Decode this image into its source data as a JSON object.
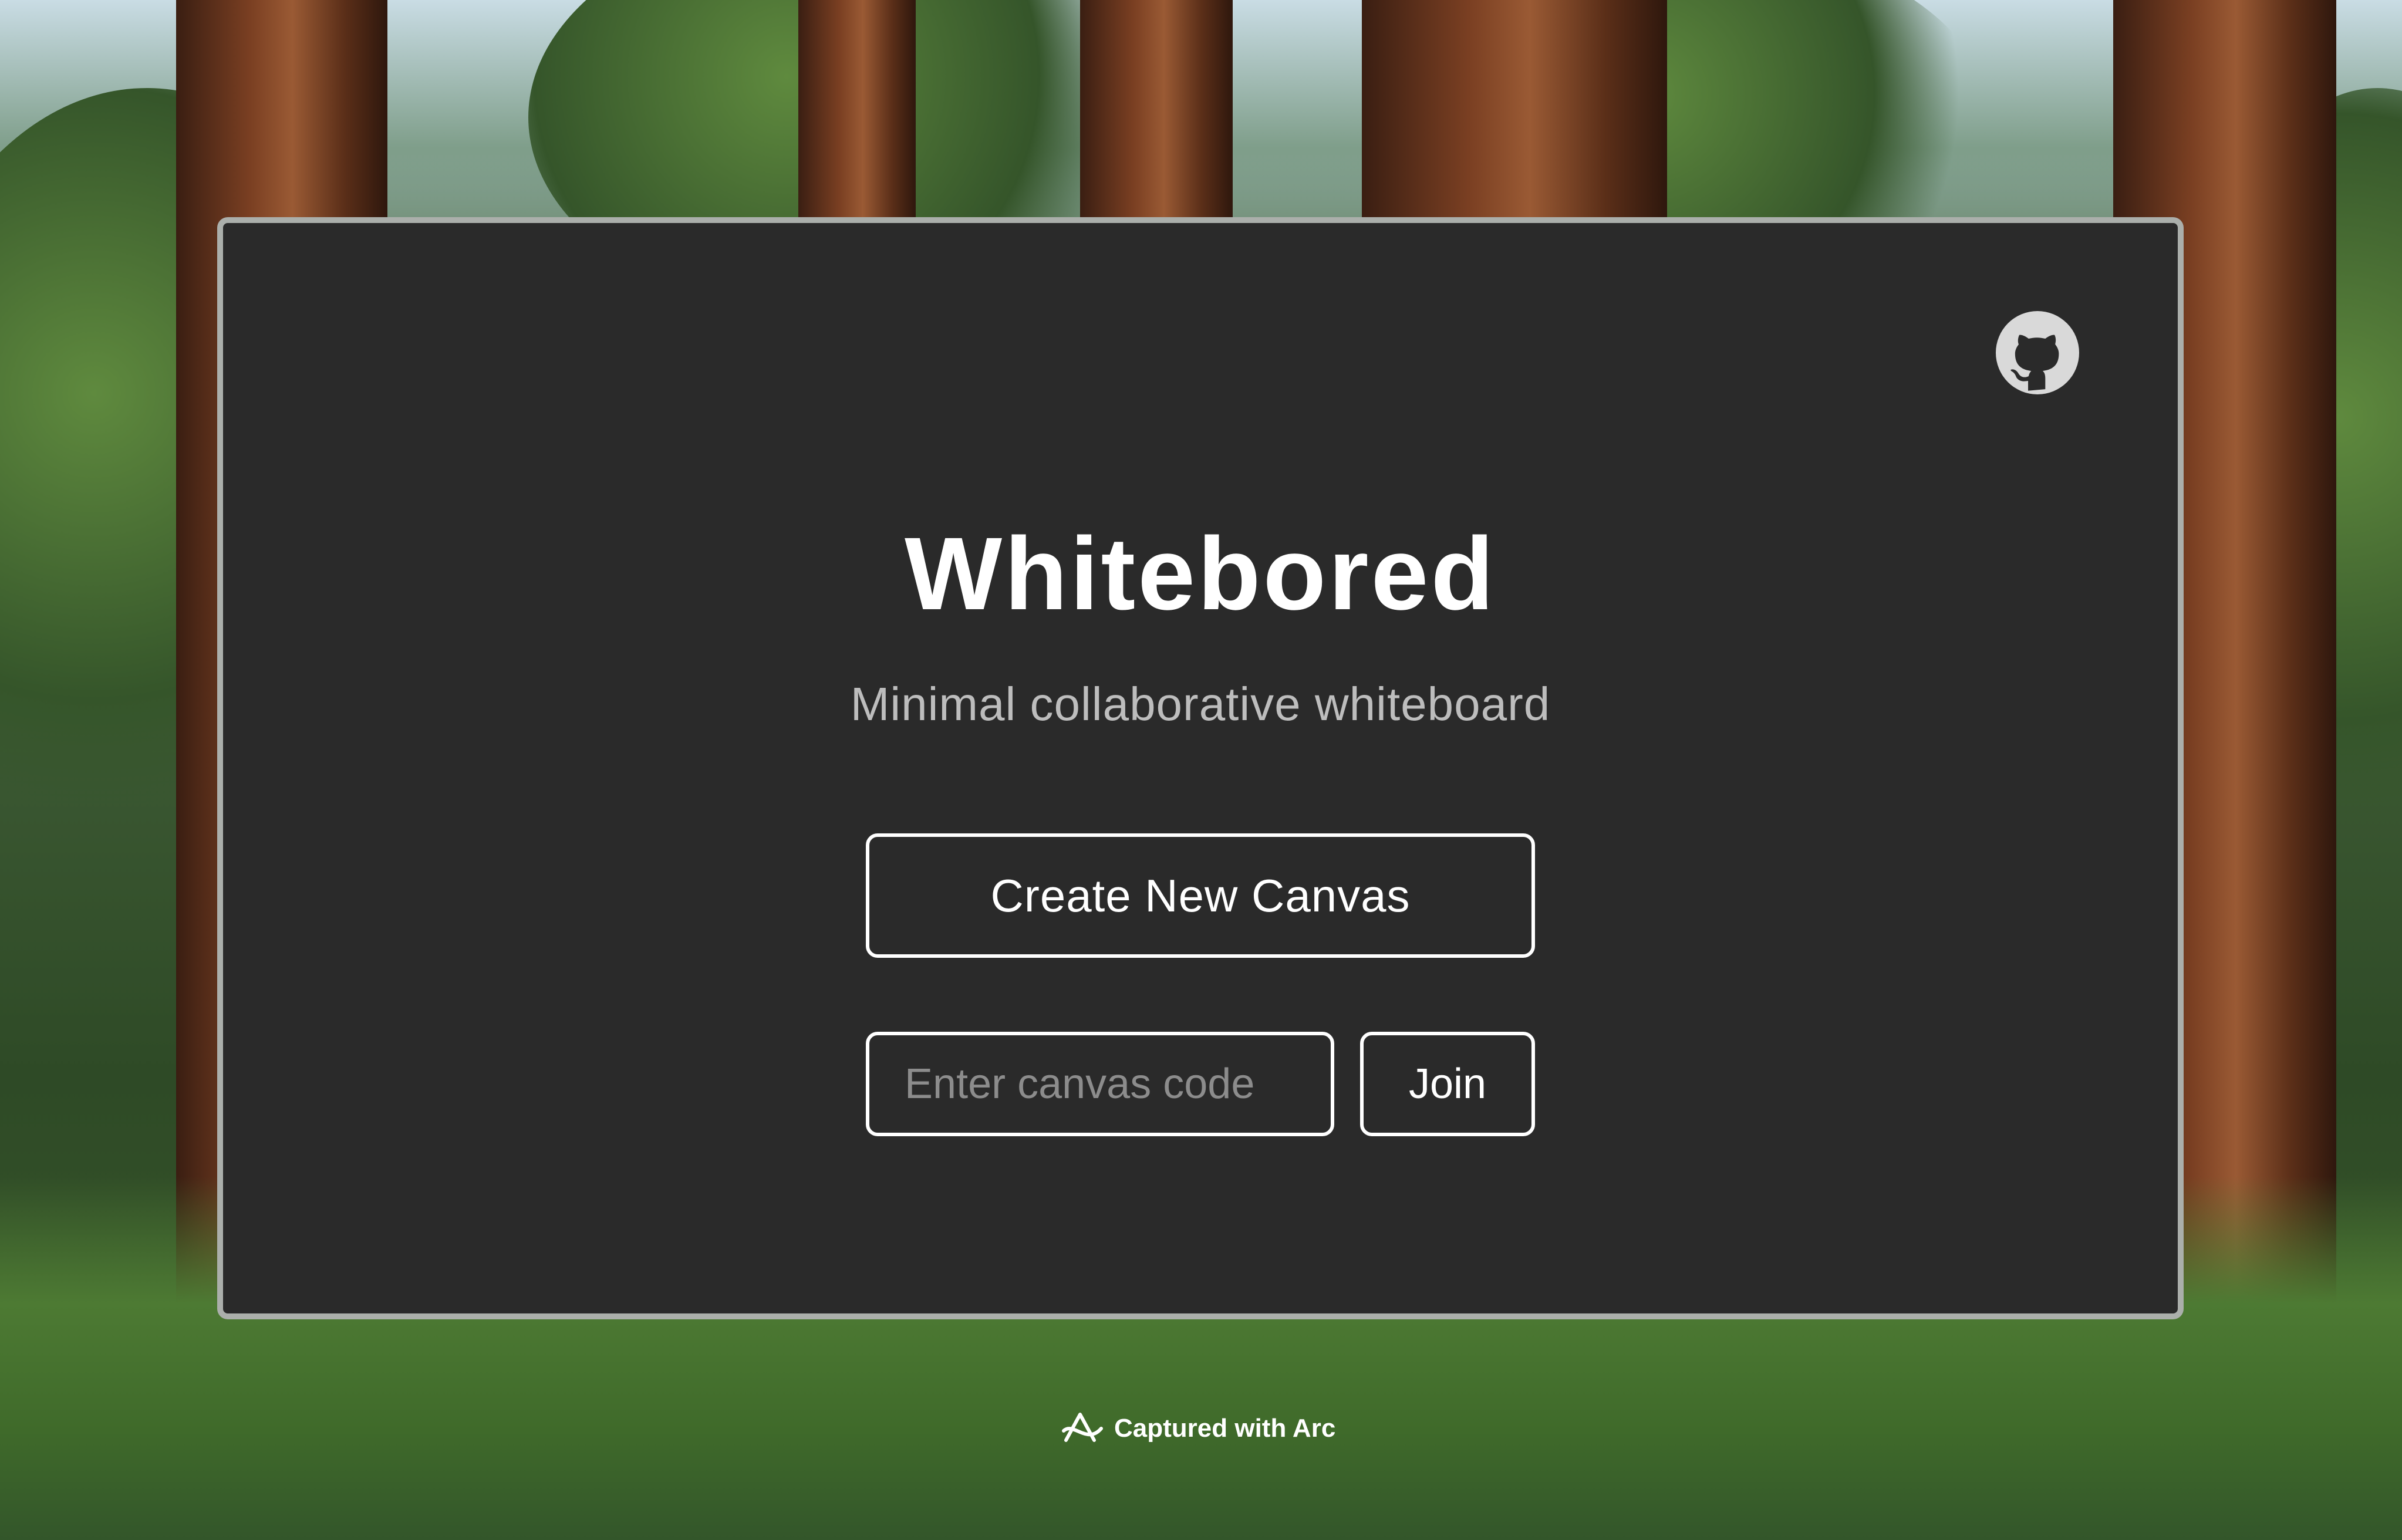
{
  "app": {
    "title": "Whitebored",
    "subtitle": "Minimal collaborative whiteboard"
  },
  "actions": {
    "create_label": "Create New Canvas",
    "join_label": "Join",
    "code_input_placeholder": "Enter canvas code",
    "code_input_value": ""
  },
  "header": {
    "repo_icon": "github-icon"
  },
  "footer": {
    "capture_credit": "Captured with Arc",
    "capture_icon": "arc-logo-icon"
  },
  "colors": {
    "card_background": "#2a2a2a",
    "card_border": "#d7dcd7",
    "text_primary": "#ffffff",
    "text_secondary": "#bdbdbd",
    "placeholder": "#8c8c8c"
  }
}
